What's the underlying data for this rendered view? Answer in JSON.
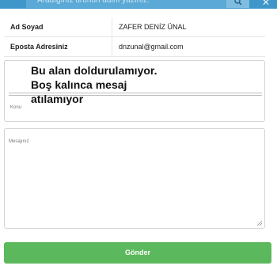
{
  "search": {
    "placeholder": "Aradığınız ürünün adını yazınız.",
    "search_icon": "search-icon",
    "close_icon": "close-icon"
  },
  "info": {
    "rows": [
      {
        "label": "Ad Soyad",
        "value": "ZAFER DENİZ ÜNAL"
      },
      {
        "label": "Eposta Adresiniz",
        "value": "dnzunal@gmail.com"
      }
    ]
  },
  "form": {
    "konu_label": "Konu",
    "mesaj_label": "Mesajınız",
    "submit_label": "Gönder"
  },
  "annotation": {
    "line1": "Bu alan doldurulamıyor.",
    "line2": "Boş kalınca mesaj",
    "line3": "atılamıyor"
  },
  "colors": {
    "topbar": "#3f97c9",
    "submit": "#5cb85c"
  }
}
